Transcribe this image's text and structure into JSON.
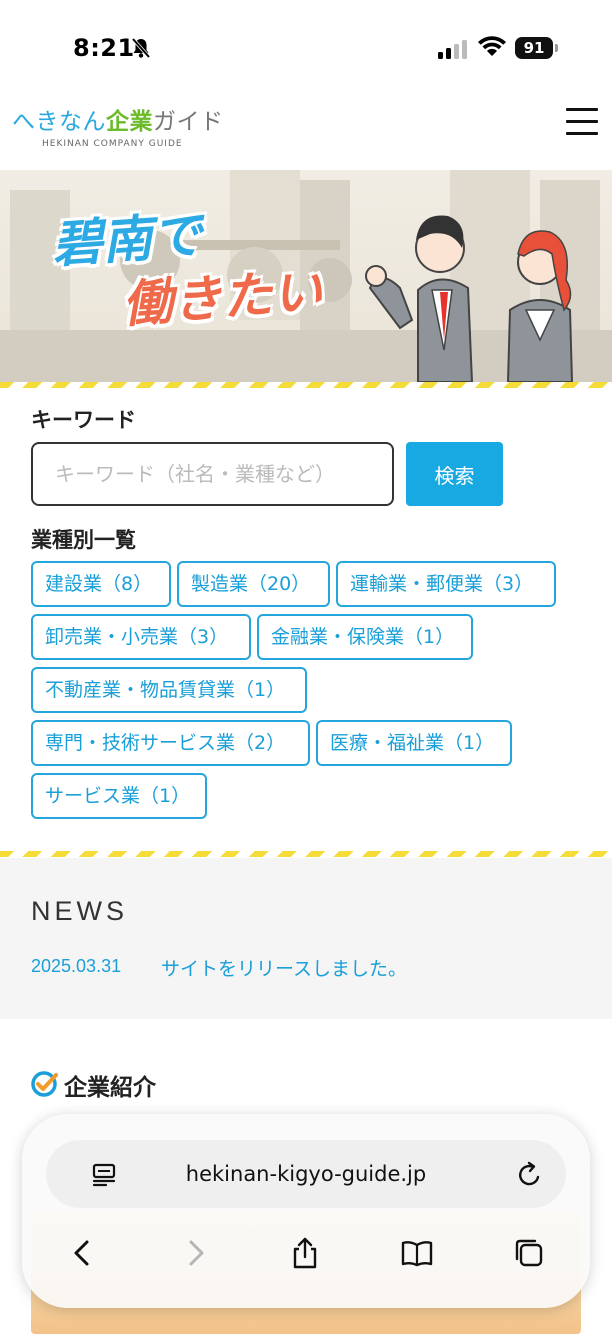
{
  "status_bar": {
    "time": "8:21",
    "battery": "91"
  },
  "header": {
    "logo_part1": "へきなん",
    "logo_part2": "企業",
    "logo_part3": "ガイド",
    "logo_sub": "HEKINAN COMPANY GUIDE"
  },
  "hero": {
    "line1": "碧南で",
    "line2": "働きたい"
  },
  "search": {
    "label": "キーワード",
    "placeholder": "キーワード（社名・業種など）",
    "button": "検索"
  },
  "categories": {
    "label": "業種別一覧",
    "items": [
      "建設業（8）",
      "製造業（20）",
      "運輸業・郵便業（3）",
      "卸売業・小売業（3）",
      "金融業・保険業（1）",
      "不動産業・物品賃貸業（1）",
      "専門・技術サービス業（2）",
      "医療・福祉業（1）",
      "サービス業（1）"
    ]
  },
  "news": {
    "heading": "NEWS",
    "items": [
      {
        "date": "2025.03.31",
        "title": "サイトをリリースしました。"
      }
    ]
  },
  "intro": {
    "title": "企業紹介"
  },
  "browser": {
    "url": "hekinan-kigyo-guide.jp"
  },
  "colors": {
    "accent": "#18a9e3",
    "stripe": "#f6dc38",
    "news_bg": "#f5f5f5"
  }
}
